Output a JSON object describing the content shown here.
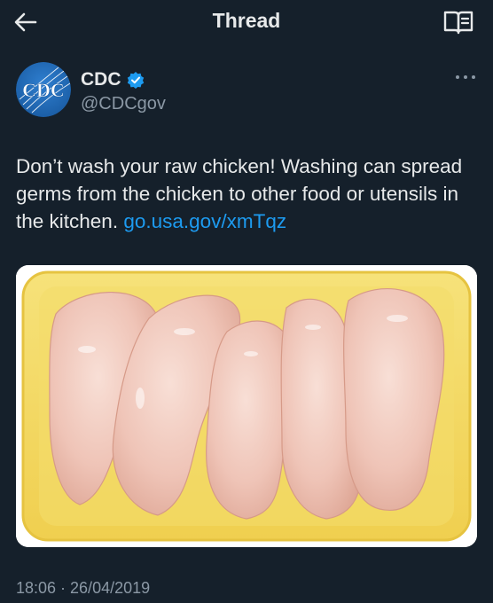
{
  "header": {
    "title": "Thread",
    "back_icon": "arrow-left-icon",
    "reader_icon": "open-book-icon"
  },
  "author": {
    "avatar_text": "CDC",
    "name": "CDC",
    "handle": "@CDCgov",
    "verified_icon": "verified-badge-icon",
    "more_icon": "more-horizontal-icon"
  },
  "post": {
    "text": "Don’t wash your raw chicken! Washing can spread germs from the chicken to other food or utensils in the kitchen.",
    "link": "go.usa.gov/xmTqz",
    "image": "raw-chicken-breasts-in-yellow-tray",
    "timestamp": "18:06 · 26/04/2019"
  },
  "colors": {
    "background": "#15202b",
    "text": "#e7e9ea",
    "secondary": "#8b98a5",
    "link": "#1d9bf0",
    "verified": "#1d9bf0"
  }
}
